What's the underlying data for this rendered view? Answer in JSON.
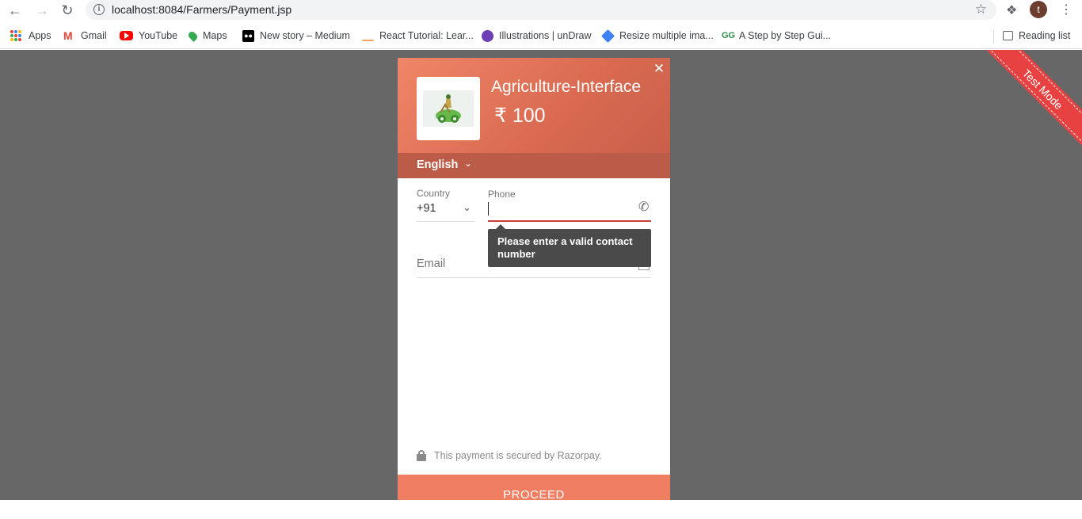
{
  "browser": {
    "url": "localhost:8084/Farmers/Payment.jsp",
    "profile_initial": "t"
  },
  "bookmarks": {
    "items": [
      {
        "label": "Apps",
        "icon": "apps-grid-icon"
      },
      {
        "label": "Gmail",
        "icon": "gmail-icon"
      },
      {
        "label": "YouTube",
        "icon": "youtube-icon"
      },
      {
        "label": "Maps",
        "icon": "maps-icon"
      },
      {
        "label": "New story – Medium",
        "icon": "medium-icon"
      },
      {
        "label": "React Tutorial: Lear...",
        "icon": "react-tutorial-icon"
      },
      {
        "label": "Illustrations | unDraw",
        "icon": "undraw-icon"
      },
      {
        "label": "Resize multiple ima...",
        "icon": "resize-icon"
      },
      {
        "label": "A Step by Step Gui...",
        "icon": "geeksforgeeks-icon"
      }
    ],
    "reading_list": "Reading list"
  },
  "ribbon": "Test Mode",
  "checkout": {
    "title": "Agriculture-Interface",
    "amount": "₹ 100",
    "language": "English",
    "country_label": "Country",
    "country_code": "+91",
    "phone_label": "Phone",
    "phone_value": "",
    "tooltip": "Please enter a valid contact number",
    "email_label": "Email",
    "secure_text": "This payment is secured by Razorpay.",
    "proceed_label": "PROCEED"
  },
  "colors": {
    "header": "#e07459",
    "lang_bar": "#ba5c48",
    "error": "#c7413a",
    "proceed": "#ef7e62",
    "overlay": "#676767",
    "ribbon": "#e84141"
  }
}
